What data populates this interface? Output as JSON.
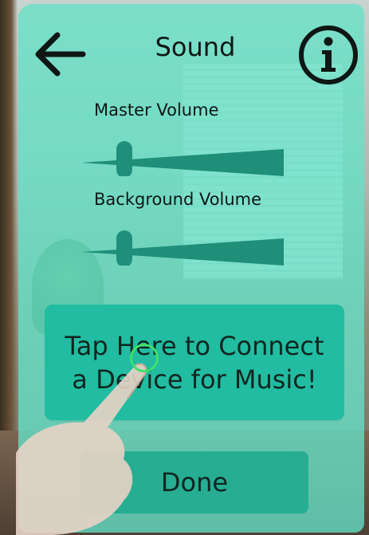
{
  "header": {
    "title": "Sound"
  },
  "sliders": [
    {
      "label": "Master Volume",
      "value": 0.2
    },
    {
      "label": "Background Volume",
      "value": 0.2
    }
  ],
  "connect_button": {
    "label": "Tap Here to Connect a Device for Music!"
  },
  "done_button": {
    "label": "Done"
  },
  "colors": {
    "panel": "#64e1c8",
    "button_primary": "#21bca1",
    "button_done": "#26ad92",
    "slider_track": "#1f8f7a",
    "text": "#0e1714",
    "tap_ring": "#3fe06c"
  },
  "icons": {
    "back": "back-arrow-icon",
    "info": "info-icon"
  }
}
